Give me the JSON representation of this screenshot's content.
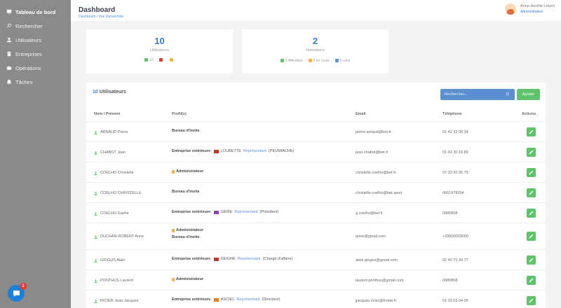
{
  "sidebar": {
    "items": [
      {
        "label": "Tableau de bord",
        "icon": "monitor-icon",
        "active": true
      },
      {
        "label": "Rechercher",
        "icon": "search-icon",
        "active": false
      },
      {
        "label": "Utilisateurs",
        "icon": "user-icon",
        "active": false
      },
      {
        "label": "Entreprises",
        "icon": "building-icon",
        "active": false
      },
      {
        "label": "Opérations",
        "icon": "briefcase-icon",
        "active": false
      },
      {
        "label": "Tâches",
        "icon": "bell-icon",
        "active": false
      }
    ]
  },
  "chat": {
    "badge": "1"
  },
  "header": {
    "title": "Dashboard",
    "breadcrumb": "Dashboard / Vue d'ensemble",
    "user_name": "Anne-Aurélie Lebert",
    "user_role": "Administrateur"
  },
  "stats": {
    "users": {
      "count": "10",
      "label": "Utilisateurs",
      "breakdown": [
        {
          "value": "10",
          "color": "#5fc36b"
        },
        {
          "value": "",
          "color": "#e53935"
        },
        {
          "value": "",
          "color": "#f7b34b"
        }
      ]
    },
    "operations": {
      "count": "2",
      "label": "Opérations",
      "breakdown": [
        {
          "text": "2 Affectées",
          "color": "#5fc36b"
        },
        {
          "text": "0 en cours",
          "color": "#f7b34b"
        },
        {
          "text": "0 suivi",
          "color": "#5b8fd9"
        }
      ]
    }
  },
  "users_panel": {
    "count": "10",
    "title": "Utilisateurs",
    "search_placeholder": "Rechercher...",
    "add_label": "Ajouter",
    "columns": {
      "name": "Nom / Prénom",
      "profile": "Profil(s)",
      "email": "Email",
      "phone": "Téléphone",
      "actions": "Actions"
    },
    "rows": [
      {
        "name": "ARNAUD Pierre",
        "profile": [
          {
            "bold": "Bureau d'invite"
          }
        ],
        "email": "pierre.arnaud@bet.fr",
        "phone": "01 42 33 08 34"
      },
      {
        "name": "CHABOT Jean",
        "profile": [
          {
            "bold": "Entreprise extérieure",
            "flag": "#c0392b",
            "company": "LOUBETTE",
            "link": "Représentant",
            "extra": "(PEUMIACHE)"
          }
        ],
        "email": "jean.chabot@bet.fr",
        "phone": "01 43 30 18 89"
      },
      {
        "name": "COELHO Christelle",
        "profile": [
          {
            "mark": true,
            "bold": "Administrateur"
          }
        ],
        "email": "christelle.coelho@bet.fr",
        "phone": "07 33 90 05 79"
      },
      {
        "name": "COELHO CHRISTELLE",
        "profile": [
          {
            "bold": "Bureau d'invite"
          }
        ],
        "email": "christelle.coelho@bet.sport",
        "phone": "0661978394"
      },
      {
        "name": "COELHO Gaëlle",
        "profile": [
          {
            "bold": "Entreprise extérieure",
            "flag": "#8e44ad",
            "company": "SERIE",
            "link": "Représentant",
            "extra": "(Président)"
          }
        ],
        "email": "g.coelho@bet.fr",
        "phone": "0980808"
      },
      {
        "name": "DUCHAN-ROBERT Anne",
        "profile": [
          {
            "mark": true,
            "bold": "Administrateur"
          },
          {
            "bold": "Bureau d'invite"
          }
        ],
        "email": "anne@gmail.com",
        "phone": "+33600000000"
      },
      {
        "name": "GIOGUS Alain",
        "profile": [
          {
            "bold": "Entreprise extérieure",
            "flag": "#c0392b",
            "company": "SEIGNE",
            "link": "Représentant",
            "extra": "(Chargé d'affaire)"
          }
        ],
        "email": "alain.giogus@gmail.com",
        "phone": "02 40 70 30 77"
      },
      {
        "name": "PONTHUS Laurent",
        "profile": [
          {
            "mark": true,
            "bold": "Administrateur"
          }
        ],
        "email": "laurent.ponthus@gmail.com",
        "phone": "0980808"
      },
      {
        "name": "RICIER Jean-Jacques",
        "profile": [
          {
            "bold": "Entreprise extérieure",
            "flag": "#e67e22",
            "company": "ASCIEL",
            "link": "Représentant",
            "extra": "(Directeur)"
          }
        ],
        "email": "jjacques.ricier@fromb.fr",
        "phone": "01 02 03 04 05"
      }
    ]
  }
}
